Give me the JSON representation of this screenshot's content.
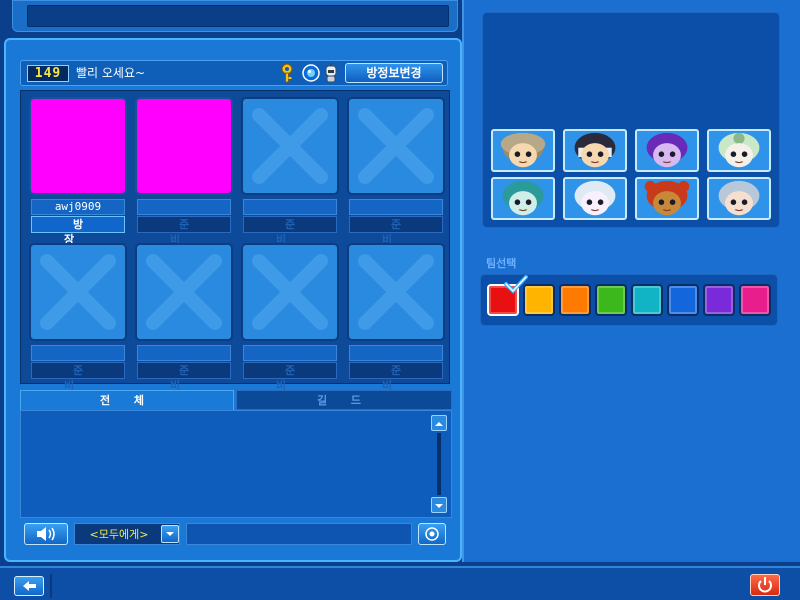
{
  "room": {
    "number": "149",
    "title": "빨리 오세요~",
    "change_button_label": "방정보변경"
  },
  "slots": [
    {
      "name": "awj0909",
      "status": "방 장",
      "occupied": true,
      "host": true
    },
    {
      "name": "",
      "status": "준 비",
      "occupied": true,
      "host": false
    },
    {
      "name": "",
      "status": "준 비",
      "occupied": false,
      "host": false
    },
    {
      "name": "",
      "status": "준 비",
      "occupied": false,
      "host": false
    },
    {
      "name": "",
      "status": "준 비",
      "occupied": false,
      "host": false
    },
    {
      "name": "",
      "status": "준 비",
      "occupied": false,
      "host": false
    },
    {
      "name": "",
      "status": "준 비",
      "occupied": false,
      "host": false
    },
    {
      "name": "",
      "status": "준 비",
      "occupied": false,
      "host": false
    }
  ],
  "chat": {
    "tabs": [
      {
        "label": "전 체",
        "active": true
      },
      {
        "label": "길 드",
        "active": false
      }
    ],
    "target": "<모두에게>",
    "input_value": ""
  },
  "characters": [
    "mushroom-character-icon",
    "masked-character-icon",
    "purple-haired-character-icon",
    "green-helmet-character-icon",
    "teal-haired-character-icon",
    "white-haired-character-icon",
    "bear-character-icon",
    "silver-haired-character-icon"
  ],
  "team": {
    "label": "팀선택",
    "colors": [
      "#e81010",
      "#ffb400",
      "#ff7a00",
      "#3cb81c",
      "#10b4c4",
      "#1466dc",
      "#7a2ad8",
      "#e81e8c"
    ],
    "selected_index": 0
  },
  "icons": {
    "key": "key-icon",
    "globe": "globe-icon",
    "robot": "robot-icon",
    "speaker": "speaker-icon",
    "emote": "emote-icon",
    "back": "back-arrow-icon",
    "power": "power-icon"
  }
}
